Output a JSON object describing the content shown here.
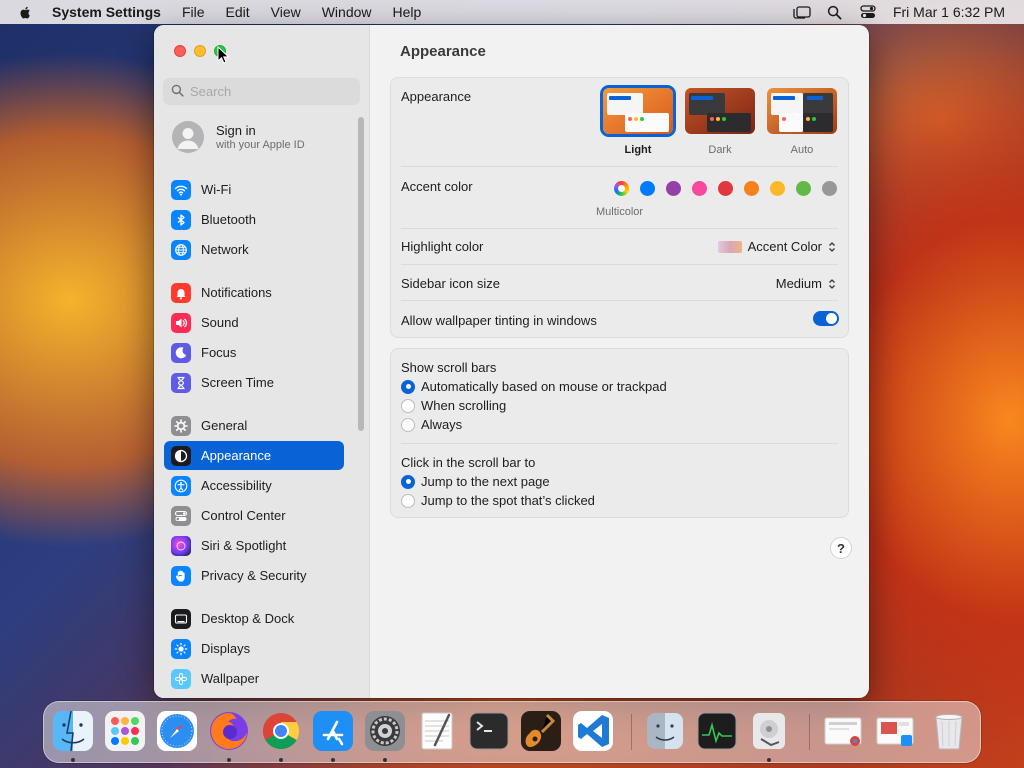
{
  "menubar": {
    "app_name": "System Settings",
    "menus": [
      "File",
      "Edit",
      "View",
      "Window",
      "Help"
    ],
    "clock": "Fri Mar 1  6:32 PM"
  },
  "sidebar": {
    "search_placeholder": "Search",
    "account": {
      "title": "Sign in",
      "subtitle": "with your Apple ID"
    },
    "items": [
      {
        "label": "Wi-Fi",
        "icon": "wifi-icon",
        "color": "#0a84ff"
      },
      {
        "label": "Bluetooth",
        "icon": "bluetooth-icon",
        "color": "#0a84ff"
      },
      {
        "label": "Network",
        "icon": "globe-icon",
        "color": "#0a84ff"
      },
      {
        "label": "Notifications",
        "icon": "bell-icon",
        "color": "#ff3b30"
      },
      {
        "label": "Sound",
        "icon": "speaker-icon",
        "color": "#ff2d55"
      },
      {
        "label": "Focus",
        "icon": "moon-icon",
        "color": "#5e5ce6"
      },
      {
        "label": "Screen Time",
        "icon": "hourglass-icon",
        "color": "#5e5ce6"
      },
      {
        "label": "General",
        "icon": "gear-icon",
        "color": "#8e8e93"
      },
      {
        "label": "Appearance",
        "icon": "appearance-icon",
        "color": "#1c1c1e"
      },
      {
        "label": "Accessibility",
        "icon": "accessibility-icon",
        "color": "#0a84ff"
      },
      {
        "label": "Control Center",
        "icon": "toggles-icon",
        "color": "#8e8e93"
      },
      {
        "label": "Siri & Spotlight",
        "icon": "siri-icon",
        "color": "#bf5af2"
      },
      {
        "label": "Privacy & Security",
        "icon": "hand-icon",
        "color": "#0a84ff"
      },
      {
        "label": "Desktop & Dock",
        "icon": "dock-icon",
        "color": "#1c1c1e"
      },
      {
        "label": "Displays",
        "icon": "sun-icon",
        "color": "#0a84ff"
      },
      {
        "label": "Wallpaper",
        "icon": "flower-icon",
        "color": "#5ac8fa"
      }
    ],
    "active": "Appearance"
  },
  "main": {
    "title": "Appearance",
    "appearance": {
      "label": "Appearance",
      "options": [
        "Light",
        "Dark",
        "Auto"
      ],
      "selected": "Light"
    },
    "accent": {
      "label": "Accent color",
      "colors": [
        "multicolor",
        "#007aff",
        "#953fa8",
        "#f84a9c",
        "#e0383e",
        "#f7821b",
        "#fcb827",
        "#62ba46",
        "#989898"
      ],
      "selected_label": "Multicolor"
    },
    "highlight": {
      "label": "Highlight color",
      "value": "Accent Color"
    },
    "sidebar_icon": {
      "label": "Sidebar icon size",
      "value": "Medium"
    },
    "tinting": {
      "label": "Allow wallpaper tinting in windows",
      "on": true
    },
    "scrollbars": {
      "label": "Show scroll bars",
      "options": [
        "Automatically based on mouse or trackpad",
        "When scrolling",
        "Always"
      ],
      "selected": 0
    },
    "click_scroll": {
      "label": "Click in the scroll bar to",
      "options": [
        "Jump to the next page",
        "Jump to the spot that’s clicked"
      ],
      "selected": 0
    },
    "help": "?"
  },
  "dock": {
    "apps": [
      "Finder",
      "Launchpad",
      "Safari",
      "Firefox",
      "Chrome",
      "App Store",
      "System Settings",
      "TextEdit",
      "Terminal",
      "GarageBand",
      "Visual Studio Code",
      "Migration Assistant",
      "Activity Monitor",
      "Disk Utility",
      "Recent Documents",
      "Recent Apps",
      "Trash"
    ]
  }
}
